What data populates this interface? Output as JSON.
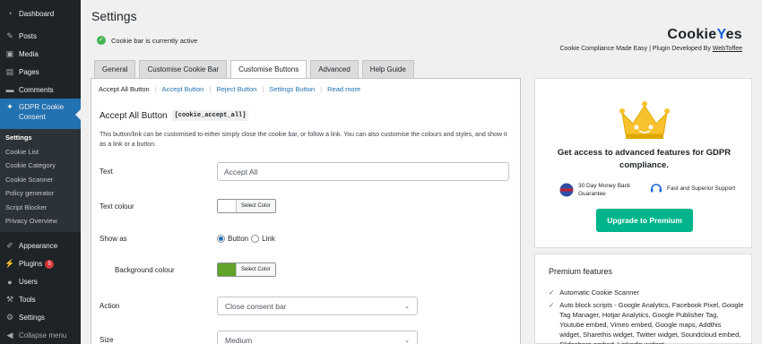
{
  "sidebar": {
    "items_top": [
      {
        "label": "Dashboard",
        "icon": "dashboard-icon"
      },
      {
        "label": "Posts",
        "icon": "pin-icon"
      },
      {
        "label": "Media",
        "icon": "media-icon"
      },
      {
        "label": "Pages",
        "icon": "pages-icon"
      },
      {
        "label": "Comments",
        "icon": "comments-icon"
      }
    ],
    "active": {
      "label": "GDPR Cookie Consent",
      "icon": "cookie-icon"
    },
    "submenu": [
      "Settings",
      "Cookie List",
      "Cookie Category",
      "Cookie Scanner",
      "Policy generator",
      "Script Blocker",
      "Privacy Overview"
    ],
    "items_bottom": [
      {
        "label": "Appearance",
        "icon": "brush-icon"
      },
      {
        "label": "Plugins",
        "icon": "plugin-icon",
        "badge": "5"
      },
      {
        "label": "Users",
        "icon": "users-icon"
      },
      {
        "label": "Tools",
        "icon": "tools-icon"
      },
      {
        "label": "Settings",
        "icon": "settings-icon"
      },
      {
        "label": "Collapse menu",
        "icon": "collapse-icon"
      }
    ]
  },
  "page": {
    "title": "Settings",
    "status": "Cookie bar is currently active"
  },
  "brand": {
    "logo_main": "Cookie",
    "logo_accent": "Y",
    "logo_end": "es",
    "tagline": "Cookie Compliance Made Easy | Plugin Developed By ",
    "developer": "WebToffee"
  },
  "tabs": [
    "General",
    "Customise Cookie Bar",
    "Customise Buttons",
    "Advanced",
    "Help Guide"
  ],
  "active_tab": "Customise Buttons",
  "subtabs": [
    "Accept All Button",
    "Accept Button",
    "Reject Button",
    "Settings Button",
    "Read more"
  ],
  "section": {
    "title": "Accept All Button",
    "code": "[cookie_accept_all]",
    "description": "This button/link can be customised to either simply close the cookie bar, or follow a link. You can also customise the colours and styles, and show it as a link or a button."
  },
  "form": {
    "text_label": "Text",
    "text_value": "Accept All",
    "text_colour_label": "Text colour",
    "select_color": "Select Color",
    "text_colour_value": "#ffffff",
    "show_as_label": "Show as",
    "show_as_options": [
      "Button",
      "Link"
    ],
    "show_as_selected": "Button",
    "bg_colour_label": "Background colour",
    "bg_colour_value": "#61a229",
    "action_label": "Action",
    "action_value": "Close consent bar",
    "size_label": "Size",
    "size_value": "Medium"
  },
  "promo": {
    "title": "Get access to advanced features for GDPR compliance.",
    "feature1": "30 Day Money Back Guarantee",
    "feature2": "Fast and Superior Support",
    "upgrade": "Upgrade to Premium"
  },
  "premium": {
    "title": "Premium features",
    "items": [
      "Automatic Cookie Scanner",
      "Auto block scripts - Google Analytics, Facebook Pixel, Google Tag Manager, Hotjar Analytics, Google Publisher Tag, Youtube embed, Vimeo embed, Google maps, Addthis widget, Sharethis widget, Twitter widget, Soundcloud embed, Slideshare embed, Linkedin widget,"
    ]
  },
  "colors": {
    "sidebar_bg": "#1d2327",
    "active_bg": "#2271b1",
    "link": "#2271b1",
    "upgrade": "#00b48b",
    "status_ok": "#46b450",
    "badge": "#d63638"
  }
}
